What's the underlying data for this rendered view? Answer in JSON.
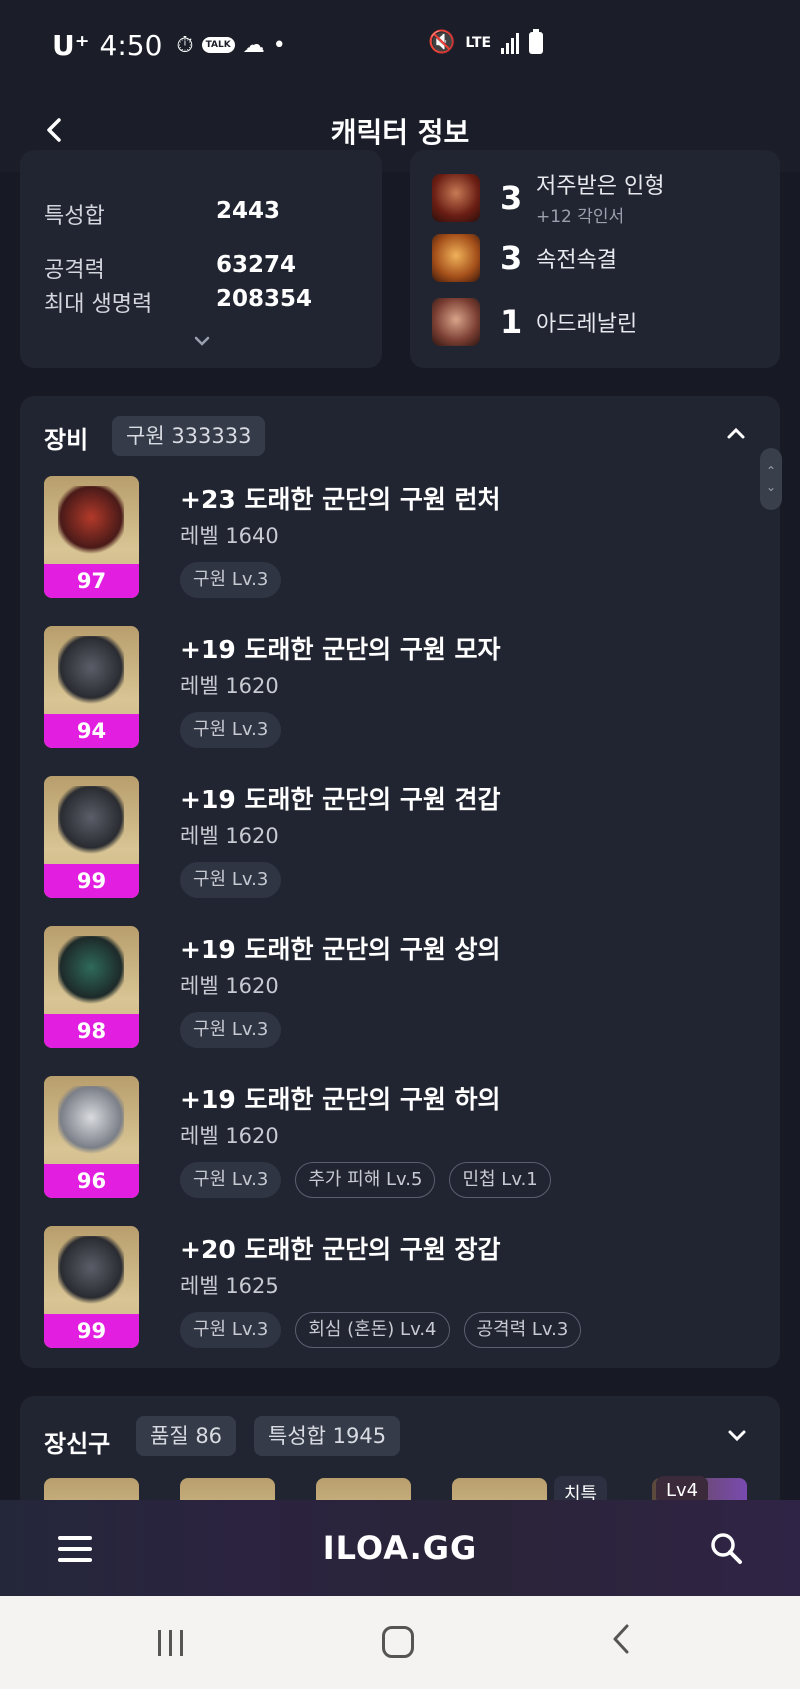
{
  "status_bar": {
    "carrier": "U⁺",
    "time": "4:50",
    "network": "LTE"
  },
  "header": {
    "title": "캐릭터 정보"
  },
  "stats": {
    "rows": [
      {
        "label": "특성합",
        "value": "2443"
      },
      {
        "label": "공격력",
        "value": "63274"
      },
      {
        "label": "최대 생명력",
        "value": "208354"
      }
    ]
  },
  "engravings": [
    {
      "level": "3",
      "name": "저주받은 인형",
      "sub": "+12 각인서"
    },
    {
      "level": "3",
      "name": "속전속결",
      "sub": ""
    },
    {
      "level": "1",
      "name": "아드레날린",
      "sub": ""
    }
  ],
  "equipment": {
    "title": "장비",
    "set_badge": "구원 333333",
    "items": [
      {
        "name": "+23 도래한 군단의 구원 런처",
        "level": "레벨 1640",
        "quality": "97",
        "tags": [
          "구원 Lv.3"
        ]
      },
      {
        "name": "+19 도래한 군단의 구원 모자",
        "level": "레벨 1620",
        "quality": "94",
        "tags": [
          "구원 Lv.3"
        ]
      },
      {
        "name": "+19 도래한 군단의 구원 견갑",
        "level": "레벨 1620",
        "quality": "99",
        "tags": [
          "구원 Lv.3"
        ]
      },
      {
        "name": "+19 도래한 군단의 구원 상의",
        "level": "레벨 1620",
        "quality": "98",
        "tags": [
          "구원 Lv.3"
        ]
      },
      {
        "name": "+19 도래한 군단의 구원 하의",
        "level": "레벨 1620",
        "quality": "96",
        "tags": [
          "구원 Lv.3",
          "추가 피해 Lv.5",
          "민첩 Lv.1"
        ]
      },
      {
        "name": "+20 도래한 군단의 구원 장갑",
        "level": "레벨 1625",
        "quality": "99",
        "tags": [
          "구원 Lv.3",
          "회심 (혼돈) Lv.4",
          "공격력 Lv.3"
        ]
      }
    ]
  },
  "accessories": {
    "title": "장신구",
    "quality_badge": "품질 86",
    "stat_badge": "특성합 1945",
    "chip_1": "치특",
    "chip_2": "Lv4"
  },
  "bottom_bar": {
    "logo": "ILOA.GG"
  },
  "colors": {
    "background": "#171a24",
    "card": "#212531",
    "quality_bar": "#e21fe0"
  }
}
